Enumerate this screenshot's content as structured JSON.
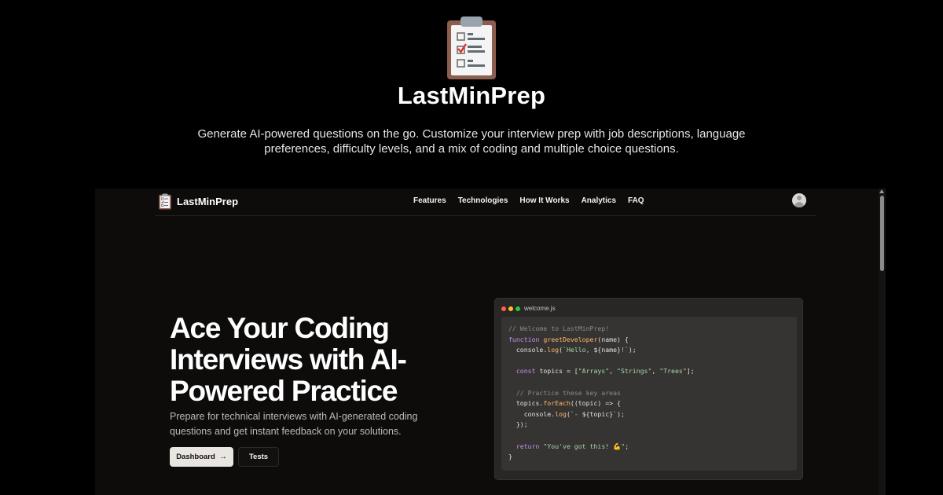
{
  "hero": {
    "title": "LastMinPrep",
    "description": "Generate AI-powered questions on the go. Customize your interview prep with job descriptions, language preferences, difficulty levels, and a mix of coding and multiple choice questions.",
    "logo_icon": "clipboard-checklist-icon"
  },
  "nav": {
    "brand": "LastMinPrep",
    "links": [
      "Features",
      "Technologies",
      "How It Works",
      "Analytics",
      "FAQ"
    ],
    "avatar_icon": "user-avatar-icon"
  },
  "main": {
    "headline_lines": [
      "Ace Your Coding",
      "Interviews with AI-",
      "Powered Practice"
    ],
    "subtext": "Prepare for technical interviews with AI-generated coding questions and get instant feedback on your solutions.",
    "primary_button": "Dashboard",
    "primary_button_icon": "arrow-right-icon",
    "secondary_button": "Tests"
  },
  "code_window": {
    "file_name": "welcome.js",
    "dot_colors": [
      "#ff5f56",
      "#ffbd2e",
      "#27c93f"
    ],
    "lines": [
      [
        {
          "t": "// Welcome to LastMinPrep!",
          "c": "comment"
        }
      ],
      [
        {
          "t": "function ",
          "c": "kw"
        },
        {
          "t": "greetDeveloper",
          "c": "fn"
        },
        {
          "t": "(name) {",
          "c": "plain"
        }
      ],
      [
        {
          "t": "  console.",
          "c": "plain"
        },
        {
          "t": "log",
          "c": "fn"
        },
        {
          "t": "(",
          "c": "plain"
        },
        {
          "t": "`Hello, ",
          "c": "str"
        },
        {
          "t": "${name}",
          "c": "plain"
        },
        {
          "t": "!`",
          "c": "str"
        },
        {
          "t": ");",
          "c": "plain"
        }
      ],
      [],
      [
        {
          "t": "  const ",
          "c": "kw"
        },
        {
          "t": "topics = [",
          "c": "plain"
        },
        {
          "t": "\"Arrays\"",
          "c": "str"
        },
        {
          "t": ", ",
          "c": "plain"
        },
        {
          "t": "\"Strings\"",
          "c": "str"
        },
        {
          "t": ", ",
          "c": "plain"
        },
        {
          "t": "\"Trees\"",
          "c": "str"
        },
        {
          "t": "];",
          "c": "plain"
        }
      ],
      [],
      [
        {
          "t": "  // Practice these key areas",
          "c": "comment"
        }
      ],
      [
        {
          "t": "  topics.",
          "c": "plain"
        },
        {
          "t": "forEach",
          "c": "fn"
        },
        {
          "t": "((topic) => {",
          "c": "plain"
        }
      ],
      [
        {
          "t": "    console.",
          "c": "plain"
        },
        {
          "t": "log",
          "c": "fn"
        },
        {
          "t": "(",
          "c": "plain"
        },
        {
          "t": "`- ",
          "c": "str"
        },
        {
          "t": "${topic}",
          "c": "plain"
        },
        {
          "t": "`",
          "c": "str"
        },
        {
          "t": ");",
          "c": "plain"
        }
      ],
      [
        {
          "t": "  });",
          "c": "plain"
        }
      ],
      [],
      [
        {
          "t": "  return ",
          "c": "kw"
        },
        {
          "t": "\"You've got this! 💪\"",
          "c": "str"
        },
        {
          "t": ";",
          "c": "plain"
        }
      ],
      [
        {
          "t": "}",
          "c": "plain"
        }
      ]
    ]
  }
}
